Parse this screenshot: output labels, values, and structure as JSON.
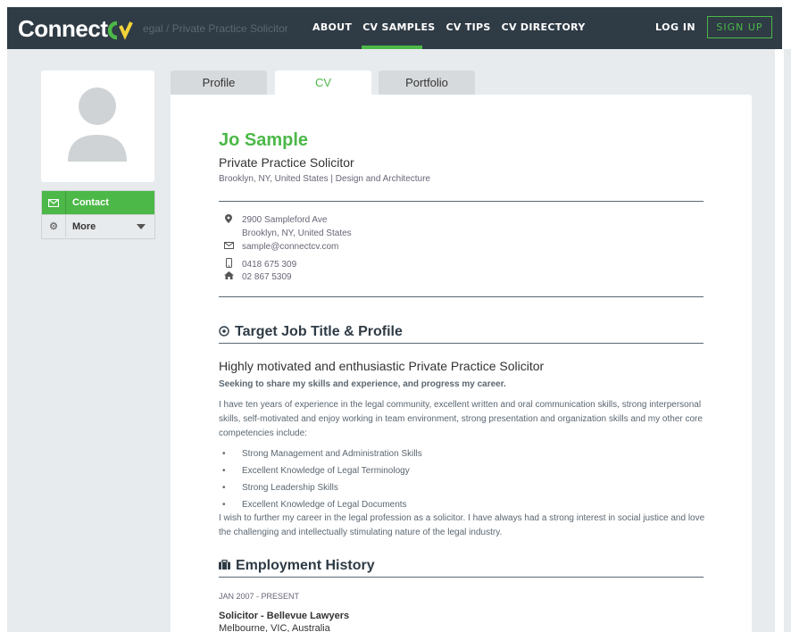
{
  "header": {
    "logo_text_1": "Connect",
    "logo_text_2": "CV",
    "breadcrumb": "egal / Private Practice Solicitor",
    "nav": [
      "ABOUT",
      "CV SAMPLES",
      "CV TIPS",
      "CV DIRECTORY"
    ],
    "login": "LOG IN",
    "signup": "SIGN UP"
  },
  "sidebar": {
    "contact_label": "Contact",
    "more_label": "More"
  },
  "tabs": [
    "Profile",
    "CV",
    "Portfolio"
  ],
  "cv": {
    "name": "Jo Sample",
    "title": "Private Practice Solicitor",
    "location": "Brooklyn, NY, United States | Design and Architecture",
    "address_line1": "2900 Sampleford Ave",
    "address_line2": "Brooklyn, NY, United States",
    "email": "sample@connectcv.com",
    "mobile": "0418 675 309",
    "phone": "02 867 5309",
    "target_heading": "Target Job Title & Profile",
    "headline": "Highly motivated and enthusiastic Private Practice Solicitor",
    "subheadline": "Seeking to share my skills and experience, and progress my career.",
    "intro": "I have ten years of experience in the legal community, excellent written and oral communication skills, strong interpersonal skills, self-motivated and enjoy working in team environment, strong presentation and organization skills and my other core competencies include:",
    "competencies": [
      "Strong Management and Administration Skills",
      "Excellent Knowledge of Legal Terminology",
      "Strong Leadership Skills",
      "Excellent Knowledge of Legal Documents"
    ],
    "closing": "I wish to further my career in the legal profession as a solicitor. I have always had a strong interest in social justice and love the challenging and intellectually stimulating nature of the legal industry.",
    "employment_heading": "Employment History",
    "emp_date": "JAN 2007 - PRESENT",
    "emp_role": "Solicitor - Bellevue Lawyers",
    "emp_location": "Melbourne, VIC, Australia"
  },
  "colors": {
    "brand_green": "#4cb848",
    "nav_bg": "#2f3b45",
    "panel_bg": "#e8ebed"
  }
}
